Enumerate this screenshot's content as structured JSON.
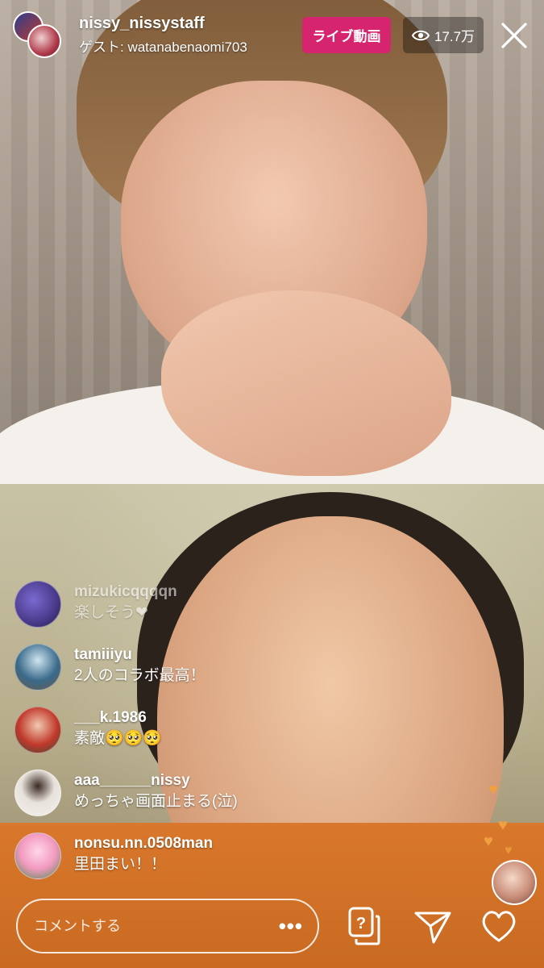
{
  "header": {
    "host_username": "nissy_nissystaff",
    "guest_line": "ゲスト: watanabenaomi703",
    "live_label": "ライブ動画",
    "viewer_count": "17.7万",
    "viewer_icon": "eye-icon",
    "close_icon": "close-icon"
  },
  "comments": [
    {
      "user": "mizukicqqqqn",
      "text": "楽しそう❤",
      "avatar_color": "#4a3a8a"
    },
    {
      "user": "tamiiiyu",
      "text": "2人のコラボ最高！",
      "avatar_color": "#3a6a8a"
    },
    {
      "user": "___k.1986",
      "text": "素敵🥺🥺🥺",
      "avatar_color": "#c0392b"
    },
    {
      "user": "aaa______nissy",
      "text": "めっちゃ画面止まる(泣)",
      "avatar_color": "#e8e2dc"
    },
    {
      "user": "nonsu.nn.0508man",
      "text": "里田まい！！",
      "avatar_color": "#f29ac0"
    }
  ],
  "input": {
    "placeholder": "コメントする",
    "more_icon": "more-icon"
  },
  "actions": {
    "question_icon": "question-box-icon",
    "send_icon": "send-icon",
    "like_icon": "heart-icon"
  },
  "colors": {
    "live_badge": "#d6246e",
    "floating_hearts": "#f0a040"
  }
}
